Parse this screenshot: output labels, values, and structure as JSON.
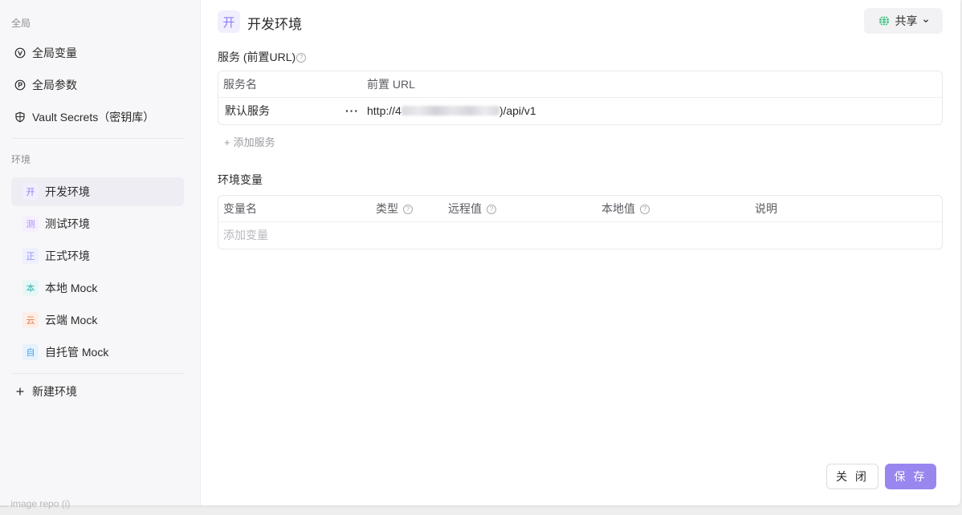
{
  "sidebar": {
    "global_label": "全局",
    "global_items": [
      {
        "label": "全局变量",
        "icon": "variable-circle-icon"
      },
      {
        "label": "全局参数",
        "icon": "parameter-circle-icon"
      },
      {
        "label": "Vault Secrets（密钥库）",
        "icon": "shield-icon"
      }
    ],
    "env_label": "环境",
    "envs": [
      {
        "badge": "开",
        "label": "开发环境",
        "color": "#8b7ef2",
        "bg": "#f1effd"
      },
      {
        "badge": "测",
        "label": "测试环境",
        "color": "#a98cf0",
        "bg": "#f4f0fd"
      },
      {
        "badge": "正",
        "label": "正式环境",
        "color": "#8b93f0",
        "bg": "#eff0fd"
      },
      {
        "badge": "本",
        "label": "本地 Mock",
        "color": "#35b8b0",
        "bg": "#e6f7f6"
      },
      {
        "badge": "云",
        "label": "云端 Mock",
        "color": "#ef7a4c",
        "bg": "#fdeee7"
      },
      {
        "badge": "自",
        "label": "自托管 Mock",
        "color": "#4aa3e8",
        "bg": "#e7f3fc"
      }
    ],
    "new_env_label": "新建环境"
  },
  "header": {
    "badge": "开",
    "title": "开发环境",
    "share_label": "共享"
  },
  "services": {
    "section_title": "服务 (前置URL)",
    "col_name": "服务名",
    "col_url": "前置 URL",
    "rows": [
      {
        "name": "默认服务",
        "more": "···",
        "url_prefix": "http://4",
        "url_suffix": ")/api/v1"
      }
    ],
    "add_label": "添加服务"
  },
  "variables": {
    "section_title": "环境变量",
    "cols": [
      "变量名",
      "类型",
      "远程值",
      "本地值",
      "说明"
    ],
    "add_placeholder": "添加变量"
  },
  "footer": {
    "close_label": "关 闭",
    "save_label": "保 存"
  },
  "under_text": "... image repo (i)"
}
